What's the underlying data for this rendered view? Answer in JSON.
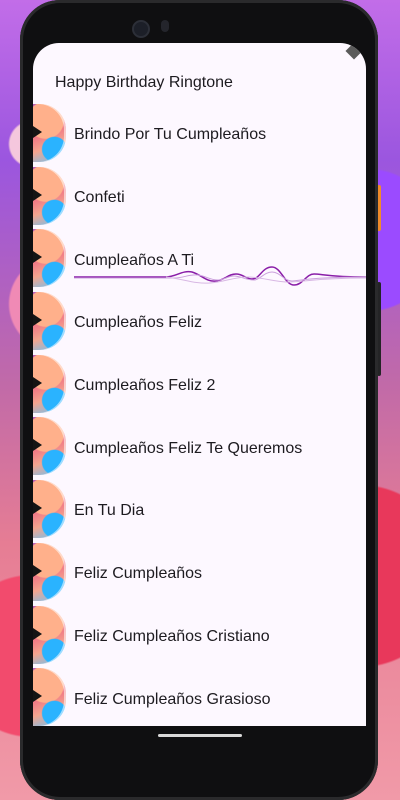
{
  "app": {
    "title": "Happy Birthday Ringtone"
  },
  "colors": {
    "screen_background": "#fdf8ff",
    "text": "#1d1b20",
    "wave": "#8a1ea8"
  },
  "ringtones": [
    {
      "label": "Brindo Por Tu Cumpleaños"
    },
    {
      "label": "Confeti"
    },
    {
      "label": "Cumpleaños A Ti",
      "playing": true
    },
    {
      "label": "Cumpleaños Feliz"
    },
    {
      "label": "Cumpleaños Feliz 2"
    },
    {
      "label": "Cumpleaños Feliz Te Queremos"
    },
    {
      "label": "En Tu Dia"
    },
    {
      "label": "Feliz Cumpleaños"
    },
    {
      "label": "Feliz Cumpleaños Cristiano"
    },
    {
      "label": "Feliz Cumpleaños Grasioso"
    }
  ],
  "icons": {
    "status": "signal-icon",
    "play": "play-icon",
    "thumbnail": "birthday-thumbnail-icon"
  }
}
